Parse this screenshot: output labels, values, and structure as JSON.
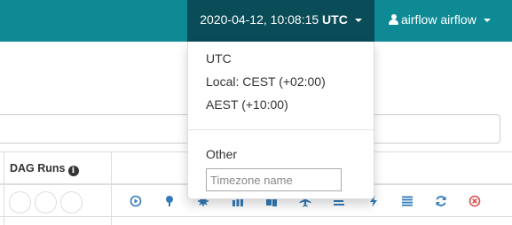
{
  "header": {
    "datetime": "2020-04-12, 10:08:15",
    "timezone": "UTC",
    "user_label": "airflow airflow"
  },
  "timezone_menu": {
    "items": [
      "UTC",
      "Local: CEST (+02:00)",
      "AEST (+10:00)"
    ],
    "other_label": "Other",
    "input_placeholder": "Timezone name"
  },
  "table": {
    "dag_runs_header": "DAG Runs",
    "info_icon": "info-icon"
  },
  "actions": [
    {
      "icon": "trigger-dag-icon",
      "color": "#337ab7"
    },
    {
      "icon": "tree-view-icon",
      "color": "#337ab7"
    },
    {
      "icon": "graph-view-icon",
      "color": "#337ab7"
    },
    {
      "icon": "duration-icon",
      "color": "#337ab7"
    },
    {
      "icon": "task-tries-icon",
      "color": "#337ab7"
    },
    {
      "icon": "landing-times-icon",
      "color": "#337ab7"
    },
    {
      "icon": "gantt-icon",
      "color": "#337ab7"
    },
    {
      "icon": "code-icon",
      "color": "#337ab7"
    },
    {
      "icon": "logs-icon",
      "color": "#337ab7"
    },
    {
      "icon": "refresh-icon",
      "color": "#337ab7"
    },
    {
      "icon": "delete-icon",
      "color": "#d9534f"
    }
  ],
  "colors": {
    "navbar": "#0e8a95",
    "navbar_active": "#0a4c57",
    "action_blue": "#337ab7",
    "delete_red": "#d9534f"
  }
}
